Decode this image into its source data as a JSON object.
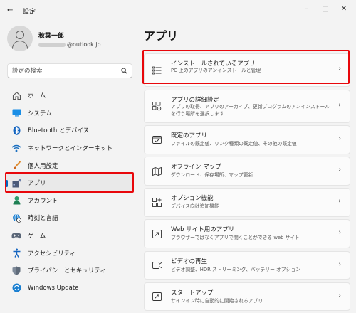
{
  "window": {
    "title": "設定",
    "back_icon": "back-arrow-icon",
    "controls": [
      "minimize-icon",
      "maximize-icon",
      "close-icon"
    ]
  },
  "profile": {
    "name": "秋葉一郎",
    "email_visible": "@outlook.jp"
  },
  "search": {
    "placeholder": "設定の検索"
  },
  "sidebar": {
    "items": [
      {
        "label": "ホーム",
        "icon": "home-icon"
      },
      {
        "label": "システム",
        "icon": "system-display-icon"
      },
      {
        "label": "Bluetooth とデバイス",
        "icon": "bluetooth-icon"
      },
      {
        "label": "ネットワークとインターネット",
        "icon": "wifi-icon"
      },
      {
        "label": "個人用設定",
        "icon": "brush-icon"
      },
      {
        "label": "アプリ",
        "icon": "apps-icon"
      },
      {
        "label": "アカウント",
        "icon": "account-icon"
      },
      {
        "label": "時刻と言語",
        "icon": "globe-clock-icon"
      },
      {
        "label": "ゲーム",
        "icon": "gamepad-icon"
      },
      {
        "label": "アクセシビリティ",
        "icon": "accessibility-icon"
      },
      {
        "label": "プライバシーとセキュリティ",
        "icon": "shield-icon"
      },
      {
        "label": "Windows Update",
        "icon": "update-icon"
      }
    ],
    "selected": "アプリ"
  },
  "main": {
    "title": "アプリ",
    "cards": [
      {
        "title": "インストールされているアプリ",
        "desc": "PC 上のアプリのアンインストールと管理",
        "icon": "installed-apps-icon"
      },
      {
        "title": "アプリの詳細設定",
        "desc": "アプリの取得、アプリのアーカイブ、更新プログラムのアンインストールを行う場所を選択します",
        "icon": "advanced-app-settings-icon"
      },
      {
        "title": "既定のアプリ",
        "desc": "ファイルの既定値、リンク種類の既定値、その他の既定値",
        "icon": "default-apps-icon"
      },
      {
        "title": "オフライン マップ",
        "desc": "ダウンロード、保存場所、マップ更新",
        "icon": "offline-maps-icon"
      },
      {
        "title": "オプション機能",
        "desc": "デバイス向け追加機能",
        "icon": "optional-features-icon"
      },
      {
        "title": "Web サイト用のアプリ",
        "desc": "ブラウザーではなくアプリで開くことができる web サイト",
        "icon": "apps-for-websites-icon"
      },
      {
        "title": "ビデオの再生",
        "desc": "ビデオ調整、HDR ストリーミング、バッテリー オプション",
        "icon": "video-playback-icon"
      },
      {
        "title": "スタートアップ",
        "desc": "サインイン時に自動的に開始されるアプリ",
        "icon": "startup-icon"
      }
    ]
  },
  "colors": {
    "accent": "#0067c0",
    "highlight_box": "#e8070b",
    "background": "#f3f3f3",
    "card": "#fbfbfb"
  }
}
